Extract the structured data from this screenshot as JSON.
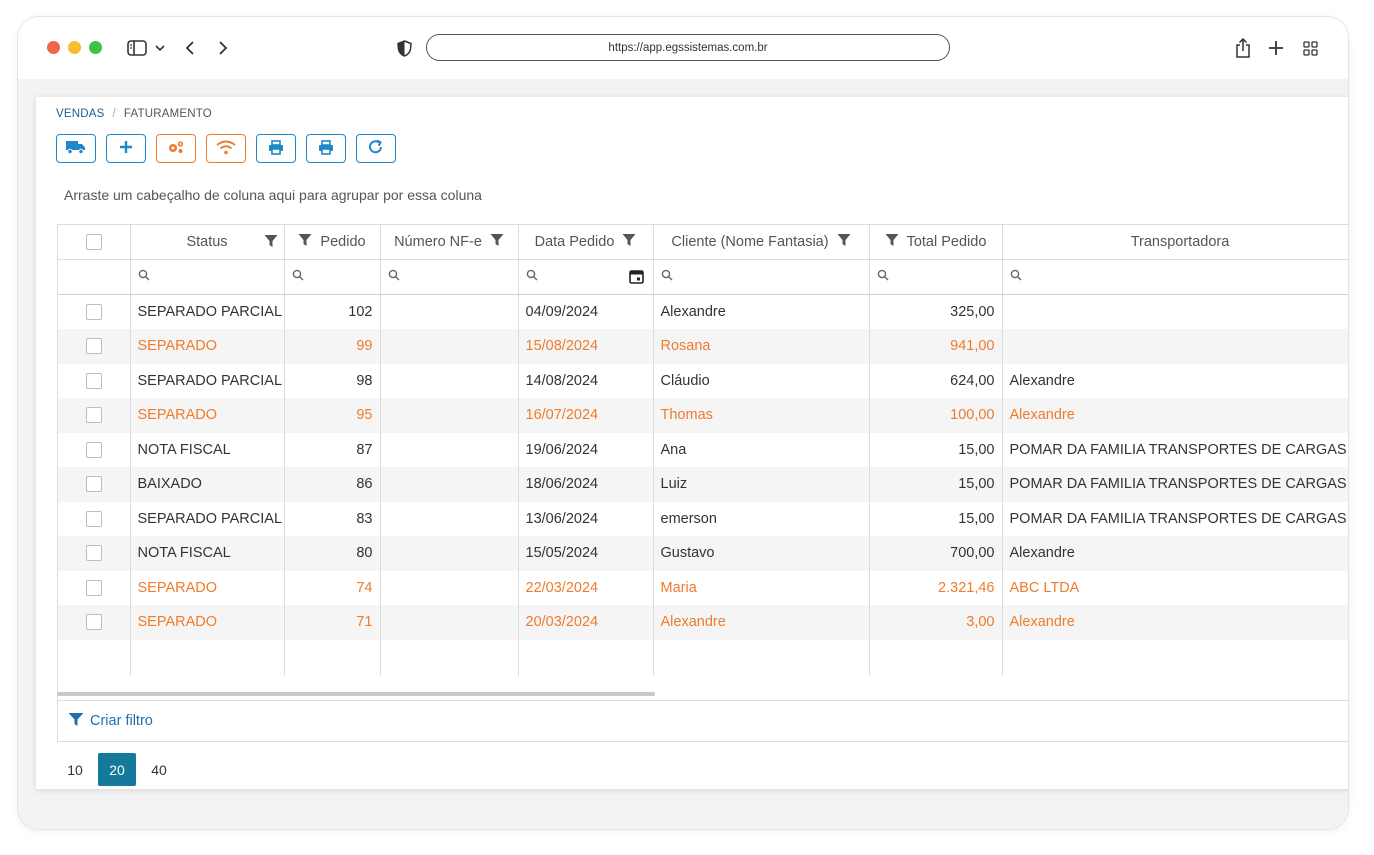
{
  "browser": {
    "url": "https://app.egssistemas.com.br"
  },
  "breadcrumb": {
    "parent": "VENDAS",
    "separator": "/",
    "current": "FATURAMENTO"
  },
  "toolbar_buttons": [
    {
      "icon": "truck-icon",
      "color": "#1e88c9"
    },
    {
      "icon": "plus-icon",
      "color": "#1e88c9"
    },
    {
      "icon": "gears-icon",
      "color": "#ef7b2c"
    },
    {
      "icon": "wifi-icon",
      "color": "#ef7b2c"
    },
    {
      "icon": "print-icon",
      "color": "#1e88c9"
    },
    {
      "icon": "print-icon",
      "color": "#1e88c9"
    },
    {
      "icon": "refresh-icon",
      "color": "#1e88c9"
    }
  ],
  "group_hint": "Arraste um cabeçalho de coluna aqui para agrupar por essa coluna",
  "grid": {
    "columns": {
      "status": "Status",
      "pedido": "Pedido",
      "numero_nfe": "Número NF-e",
      "data_pedido": "Data Pedido",
      "cliente": "Cliente (Nome Fantasia)",
      "total": "Total Pedido",
      "transportadora": "Transportadora"
    },
    "rows": [
      {
        "status": "SEPARADO PARCIAL",
        "pedido": "102",
        "nfe": "",
        "data": "04/09/2024",
        "cliente": "Alexandre",
        "total": "325,00",
        "transportadora": ""
      },
      {
        "status": "SEPARADO",
        "pedido": "99",
        "nfe": "",
        "data": "15/08/2024",
        "cliente": "Rosana",
        "total": "941,00",
        "transportadora": ""
      },
      {
        "status": "SEPARADO PARCIAL",
        "pedido": "98",
        "nfe": "",
        "data": "14/08/2024",
        "cliente": "Cláudio",
        "total": "624,00",
        "transportadora": "Alexandre"
      },
      {
        "status": "SEPARADO",
        "pedido": "95",
        "nfe": "",
        "data": "16/07/2024",
        "cliente": "Thomas",
        "total": "100,00",
        "transportadora": "Alexandre"
      },
      {
        "status": "NOTA FISCAL",
        "pedido": "87",
        "nfe": "",
        "data": "19/06/2024",
        "cliente": "Ana",
        "total": "15,00",
        "transportadora": "POMAR DA FAMILIA TRANSPORTES DE CARGAS EM"
      },
      {
        "status": "BAIXADO",
        "pedido": "86",
        "nfe": "",
        "data": "18/06/2024",
        "cliente": "Luiz",
        "total": "15,00",
        "transportadora": "POMAR DA FAMILIA TRANSPORTES DE CARGAS EM"
      },
      {
        "status": "SEPARADO PARCIAL",
        "pedido": "83",
        "nfe": "",
        "data": "13/06/2024",
        "cliente": "emerson",
        "total": "15,00",
        "transportadora": "POMAR DA FAMILIA TRANSPORTES DE CARGAS EM"
      },
      {
        "status": "NOTA FISCAL",
        "pedido": "80",
        "nfe": "",
        "data": "15/05/2024",
        "cliente": "Gustavo",
        "total": "700,00",
        "transportadora": "Alexandre"
      },
      {
        "status": "SEPARADO",
        "pedido": "74",
        "nfe": "",
        "data": "22/03/2024",
        "cliente": "Maria",
        "total": "2.321,46",
        "transportadora": "ABC LTDA"
      },
      {
        "status": "SEPARADO",
        "pedido": "71",
        "nfe": "",
        "data": "20/03/2024",
        "cliente": "Alexandre",
        "total": "3,00",
        "transportadora": "Alexandre"
      }
    ],
    "highlight_color": "#ef7b2c"
  },
  "filter_bar": {
    "label": "Criar filtro"
  },
  "pager": {
    "sizes": [
      "10",
      "20",
      "40"
    ],
    "selected": "20"
  }
}
